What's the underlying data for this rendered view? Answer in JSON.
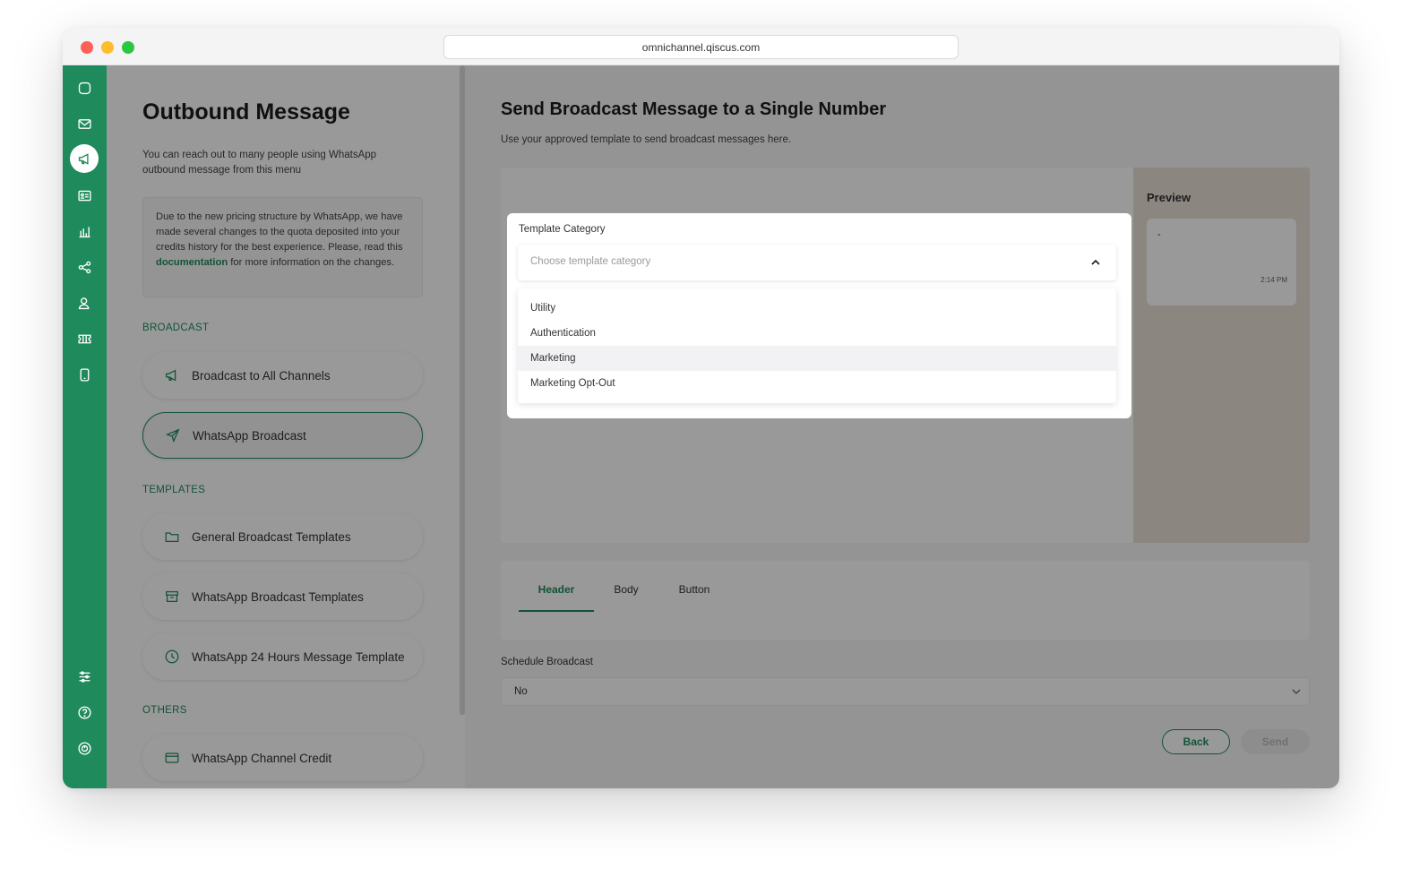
{
  "browser": {
    "url": "omnichannel.qiscus.com"
  },
  "rail": {
    "icons": [
      "chat-icon",
      "inbox-icon",
      "broadcast-icon",
      "contacts-icon",
      "analytics-icon",
      "integration-icon",
      "agent-icon",
      "ticket-icon",
      "device-icon",
      "settings-icon",
      "help-icon",
      "power-icon"
    ],
    "active": "broadcast-icon",
    "colors": {
      "rail": "#1f8a5c"
    }
  },
  "left": {
    "title": "Outbound Message",
    "description": "You can reach out to many people using WhatsApp outbound message from this menu",
    "notice": {
      "before": "Due to the new pricing structure by WhatsApp, we have made several changes to the quota deposited into your credits history for the best experience. Please, read this ",
      "link": "documentation",
      "after": " for more information on the changes."
    },
    "sections": {
      "broadcast": "BROADCAST",
      "templates": "TEMPLATES",
      "others": "OTHERS"
    },
    "items": {
      "all_channels": "Broadcast to All Channels",
      "wa_broadcast": "WhatsApp Broadcast",
      "general_templates": "General Broadcast Templates",
      "wa_templates": "WhatsApp Broadcast Templates",
      "wa_24h": "WhatsApp 24 Hours Message Template",
      "wa_credit": "WhatsApp Channel Credit"
    }
  },
  "main": {
    "title": "Send Broadcast Message to a Single Number",
    "subtitle": "Use your approved template to send broadcast messages here.",
    "preview": {
      "title": "Preview",
      "text": "-",
      "time": "2:14 PM"
    },
    "tabs": [
      "Header",
      "Body",
      "Button"
    ],
    "active_tab": "Header",
    "schedule": {
      "label": "Schedule Broadcast",
      "value": "No"
    },
    "buttons": {
      "back": "Back",
      "send": "Send"
    }
  },
  "modal": {
    "label": "Template Category",
    "placeholder": "Choose template category",
    "options": [
      "Utility",
      "Authentication",
      "Marketing",
      "Marketing Opt-Out"
    ],
    "hovered": "Marketing"
  }
}
